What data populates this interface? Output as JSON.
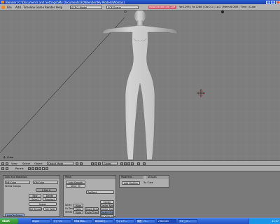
{
  "titlebar": {
    "title": "Blender [C:\\Documents and Settings\\\\My Documents\\3D\\Blender\\My Models\\Woman]"
  },
  "menubar": {
    "items": [
      "File",
      "Add",
      "Timeline",
      "Game",
      "Render",
      "Help"
    ],
    "screen_field": "SCR:2-Model",
    "scene_field": "SCE:Scene",
    "url": "www.blender.org 249",
    "stats": "Ve:1295 | Fa:1286 | Ob:0-1 | La:2 | Mem:8.06M | Time | Cube"
  },
  "viewport": {
    "active_object_label": "(1) Cube",
    "model": "female base mesh"
  },
  "view3d_header": {
    "menus": [
      "View",
      "Select",
      "Object"
    ],
    "mode": "Object Mode",
    "pivot": "Global"
  },
  "buttons_header": {
    "panels_label": "Panels"
  },
  "panels": {
    "link_materials": {
      "title": "Link and Materials",
      "me_field": "ME:Cube",
      "ob_field": "OB:Cube",
      "vertex_groups": "Vertex Groups",
      "mat_index": "0 Mat 0",
      "buttons": [
        "New",
        "Delete",
        "Select",
        "Deselect",
        "Assign"
      ],
      "set_smooth": "Set Smooth",
      "set_solid": "Set Solid",
      "autotex": "AutoTexSpace"
    },
    "mesh": {
      "title": "Mesh",
      "auto_smooth": "Auto Smooth",
      "degr": "Degr: 30",
      "texmesh": "TexMesh",
      "sticky": "Sticky",
      "uv_texture": "UV Texture",
      "vertex_color": "Vertex Color",
      "make": "Make",
      "center_btns": [
        "Center",
        "Center New",
        "Center Cursor"
      ],
      "double_sided": "Double Sided",
      "no_v_normal_flip": "No V.Normal Flip",
      "slow_parent": "SlowerDraw",
      "faster_draw": "FasterDraw"
    },
    "modifiers": {
      "tabs": [
        "Modifiers",
        "Shapes"
      ],
      "add_modifier": "Add Modifier",
      "to_label": "To: Cube"
    }
  },
  "taskbar": {
    "start_label": "start",
    "tasks": [
      "Skype",
      "ファイル",
      "MSN Mes...",
      "Blender [...",
      "ウィンド...",
      "無題 - ペ...",
      "2 Blender",
      "ドキュメ..."
    ],
    "clock": "14:37"
  },
  "colors": {
    "viewport_bg": "#7d7d7d",
    "grid_line": "#868686",
    "xp_blue": "#2553c6",
    "start_green": "#3a9e37"
  }
}
